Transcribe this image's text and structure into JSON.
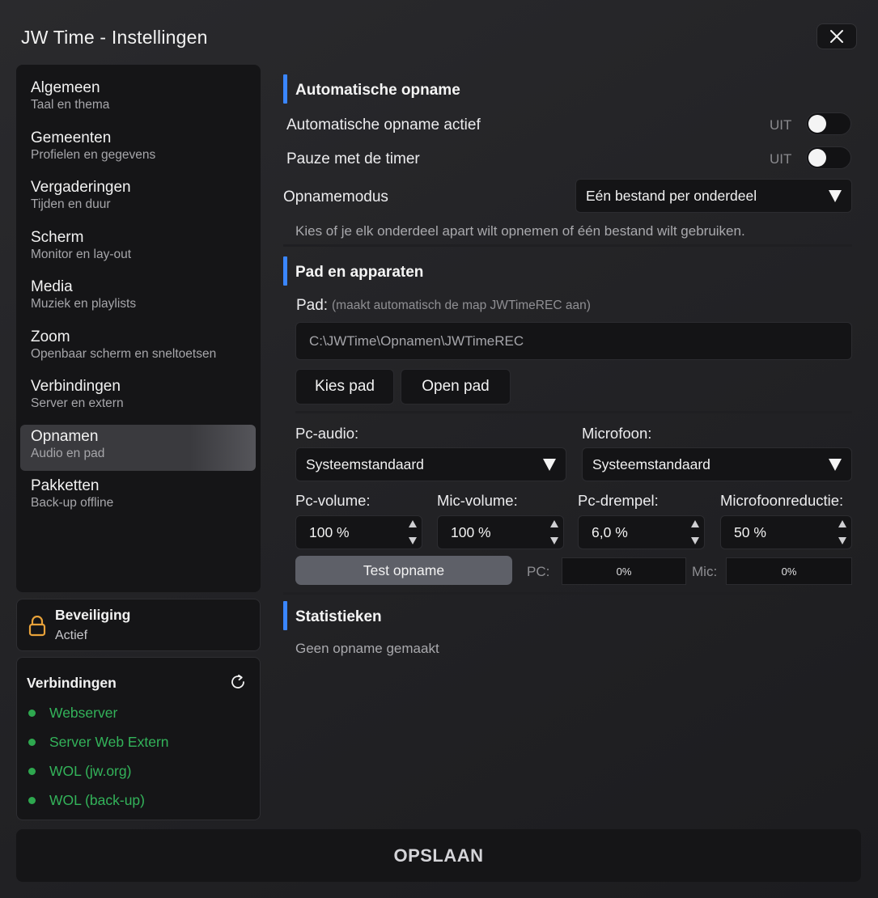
{
  "window": {
    "title": "JW Time - Instellingen"
  },
  "sidebar": {
    "items": [
      {
        "label": "Algemeen",
        "sub": "Taal en thema"
      },
      {
        "label": "Gemeenten",
        "sub": "Profielen en gegevens"
      },
      {
        "label": "Vergaderingen",
        "sub": "Tijden en duur"
      },
      {
        "label": "Scherm",
        "sub": "Monitor en lay-out"
      },
      {
        "label": "Media",
        "sub": "Muziek en playlists"
      },
      {
        "label": "Zoom",
        "sub": "Openbaar scherm en sneltoetsen"
      },
      {
        "label": "Verbindingen",
        "sub": "Server en extern"
      },
      {
        "label": "Opnamen",
        "sub": "Audio en pad"
      },
      {
        "label": "Pakketten",
        "sub": "Back-up offline"
      }
    ],
    "active_index": 7
  },
  "security": {
    "title": "Beveiliging",
    "status": "Actief"
  },
  "connections": {
    "title": "Verbindingen",
    "items": [
      {
        "label": "Webserver"
      },
      {
        "label": "Server Web Extern"
      },
      {
        "label": "WOL (jw.org)"
      },
      {
        "label": "WOL (back-up)"
      }
    ],
    "status_color": "#2ea84f"
  },
  "auto_recording": {
    "title": "Automatische opname",
    "auto_active_label": "Automatische opname actief",
    "auto_active_state": "UIT",
    "pause_label": "Pauze met de timer",
    "pause_state": "UIT",
    "mode_label": "Opnamemodus",
    "mode_value": "Eén bestand per onderdeel",
    "mode_hint": "Kies of je elk onderdeel apart wilt opnemen of één bestand wilt gebruiken."
  },
  "path_devices": {
    "title": "Pad en apparaten",
    "path_label": "Pad:",
    "path_hint": "(maakt automatisch de map JWTimeREC aan)",
    "path_value": "C:\\JWTime\\Opnamen\\JWTimeREC",
    "choose_path_label": "Kies pad",
    "open_path_label": "Open pad",
    "pc_audio_label": "Pc-audio:",
    "pc_audio_value": "Systeemstandaard",
    "mic_label": "Microfoon:",
    "mic_value": "Systeemstandaard",
    "pc_volume_label": "Pc-volume:",
    "pc_volume_value": "100 %",
    "mic_volume_label": "Mic-volume:",
    "mic_volume_value": "100 %",
    "pc_threshold_label": "Pc-drempel:",
    "pc_threshold_value": "6,0 %",
    "mic_reduction_label": "Microfoonreductie:",
    "mic_reduction_value": "50 %",
    "test_label": "Test opname",
    "pc_meter_label": "PC:",
    "pc_meter_value": "0%",
    "mic_meter_label": "Mic:",
    "mic_meter_value": "0%"
  },
  "statistics": {
    "title": "Statistieken",
    "empty": "Geen opname gemaakt"
  },
  "footer": {
    "save_label": "OPSLAAN"
  },
  "colors": {
    "accent": "#3a86ff",
    "lock": "#e8a23a"
  }
}
